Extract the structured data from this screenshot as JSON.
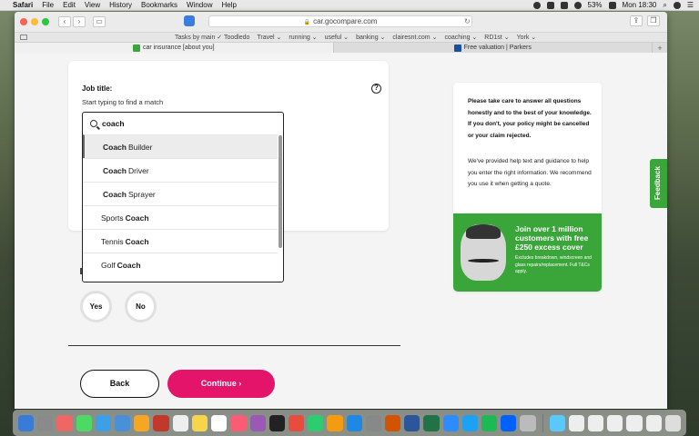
{
  "menubar": {
    "apple": "",
    "app": "Safari",
    "items": [
      "File",
      "Edit",
      "View",
      "History",
      "Bookmarks",
      "Window",
      "Help"
    ],
    "battery": "53%",
    "clock": "Mon 18:30"
  },
  "browser": {
    "url": "car.gocompare.com",
    "bookmarks": [
      "Tasks by main ✓ Toodledo",
      "Travel ⌄",
      "running ⌄",
      "useful ⌄",
      "banking ⌄",
      "clairesnt.com ⌄",
      "coaching ⌄",
      "RD1st ⌄",
      "York ⌄"
    ],
    "tabs": [
      {
        "label": "car insurance [about you]",
        "favicon_color": "#3aa63a"
      },
      {
        "label": "Free valuation | Parkers",
        "favicon_color": "#1a4fa0"
      }
    ]
  },
  "form": {
    "job_title_label": "Job title:",
    "job_title_hint": "Start typing to find a match",
    "help_symbol": "?",
    "search_value": "coach",
    "options": [
      {
        "before": "",
        "bold": "Coach",
        "after": "Builder"
      },
      {
        "before": "",
        "bold": "Coach",
        "after": "Driver"
      },
      {
        "before": "",
        "bold": "Coach",
        "after": "Sprayer"
      },
      {
        "before": "Sports",
        "bold": "Coach",
        "after": ""
      },
      {
        "before": "Tennis",
        "bold": "Coach",
        "after": ""
      },
      {
        "before": "Golf",
        "bold": "Coach",
        "after": ""
      }
    ],
    "yes_label": "Yes",
    "no_label": "No",
    "back_label": "Back",
    "continue_label": "Continue ›"
  },
  "sidebar": {
    "warning": "Please take care to answer all questions honestly and to the best of your knowledge. If you don't, your policy might be cancelled or your claim rejected.",
    "info": "We've provided help text and guidance to help you enter the right information. We recommend you use it when getting a quote.",
    "promo_head": "Join over 1 million customers with free £250 excess cover",
    "promo_small": "Excludes breakdown, windscreen and glass repairs/replacement. Full T&Cs apply."
  },
  "feedback_label": "Feedback",
  "colors": {
    "brand_pink": "#e5146b",
    "brand_green": "#3aa63a"
  }
}
